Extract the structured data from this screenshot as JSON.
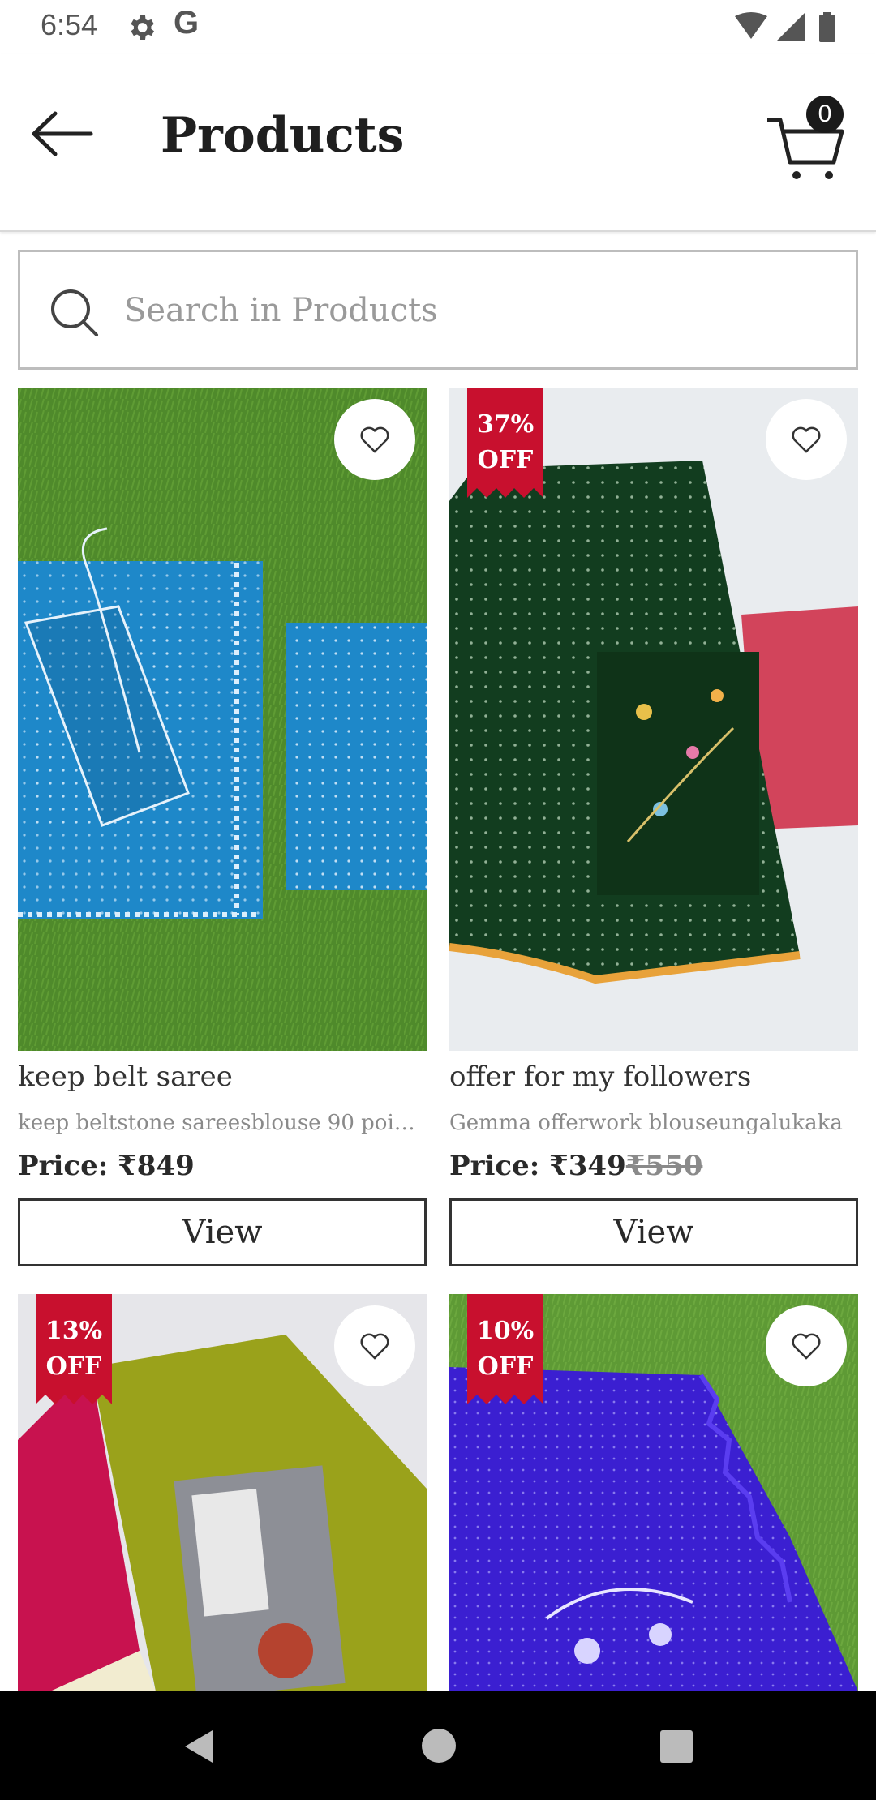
{
  "status": {
    "time": "6:54",
    "g_label": "G",
    "icons": [
      "gear-icon",
      "wifi-icon",
      "signal-icon",
      "battery-icon"
    ]
  },
  "appbar": {
    "title": "Products",
    "cart_count": "0",
    "icons": [
      "arrow-left-icon",
      "cart-icon"
    ]
  },
  "search": {
    "placeholder": "Search in Products",
    "value": ""
  },
  "colors": {
    "badge": "#c8102e",
    "text": "#222222"
  },
  "products": [
    {
      "name": "keep belt saree",
      "description": "keep beltstone sareesblouse 90 point…",
      "price": "Price: ₹849",
      "old_price": "",
      "discount": "",
      "view_label": "View"
    },
    {
      "name": "offer for my followers",
      "description": "Gemma offerwork blouseungalukaka",
      "price": "Price: ₹349",
      "old_price": "₹550",
      "discount_line1": "37%",
      "discount_line2": "OFF",
      "view_label": "View"
    },
    {
      "name": "",
      "description": "",
      "price": "",
      "old_price": "",
      "discount_line1": "13%",
      "discount_line2": "OFF",
      "view_label": ""
    },
    {
      "name": "",
      "description": "",
      "price": "",
      "old_price": "",
      "discount_line1": "10%",
      "discount_line2": "OFF",
      "view_label": ""
    }
  ],
  "navbar": {
    "icons": [
      "back-triangle-icon",
      "home-circle-icon",
      "recents-square-icon"
    ]
  }
}
